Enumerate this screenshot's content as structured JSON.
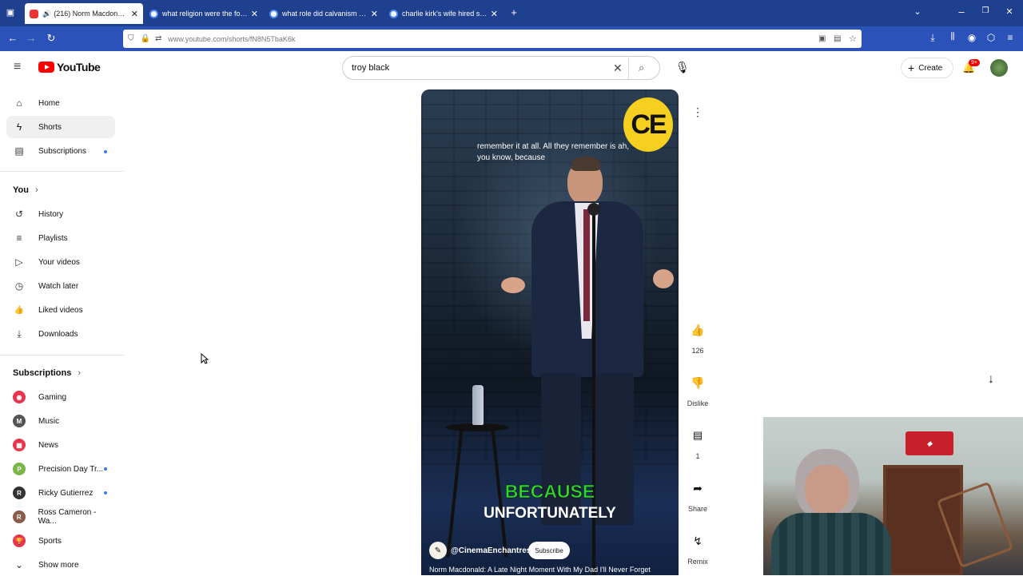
{
  "browser": {
    "tabs": [
      {
        "title": "(216) Norm Macdonald: A L",
        "fav": "#e33",
        "active": true
      },
      {
        "title": "what religion were the founding",
        "fav": "#4a8af4",
        "active": false
      },
      {
        "title": "what role did calvanism play in",
        "fav": "#4a8af4",
        "active": false
      },
      {
        "title": "charlie kirk's wife hired someon",
        "fav": "#4a8af4",
        "active": false
      }
    ],
    "url": "www.youtube.com/shorts/fN8N5TbaK6k"
  },
  "youtube": {
    "logo": "YouTube",
    "search_value": "troy black",
    "create_label": "Create",
    "notif_badge": "9+"
  },
  "sidebar": {
    "main": [
      {
        "label": "Home",
        "icon": "home-icon",
        "glyph": "⌂"
      },
      {
        "label": "Shorts",
        "icon": "shorts-icon",
        "glyph": "ϟ"
      },
      {
        "label": "Subscriptions",
        "icon": "subscriptions-icon",
        "glyph": "▤"
      }
    ],
    "you_title": "You",
    "you": [
      {
        "label": "History",
        "icon": "history-icon",
        "glyph": "↺"
      },
      {
        "label": "Playlists",
        "icon": "playlists-icon",
        "glyph": "≡"
      },
      {
        "label": "Your videos",
        "icon": "your-videos-icon",
        "glyph": "▷"
      },
      {
        "label": "Watch later",
        "icon": "watch-later-icon",
        "glyph": "◷"
      },
      {
        "label": "Liked videos",
        "icon": "liked-videos-icon",
        "glyph": "👍"
      },
      {
        "label": "Downloads",
        "icon": "downloads-icon",
        "glyph": "⤓"
      }
    ],
    "subs_title": "Subscriptions",
    "subs": [
      {
        "label": "Gaming",
        "color": "#e8344c",
        "letter": "◉"
      },
      {
        "label": "Music",
        "color": "#555555",
        "letter": "M"
      },
      {
        "label": "News",
        "color": "#e8344c",
        "letter": "▦"
      },
      {
        "label": "Precision Day Tr...",
        "color": "#7ab648",
        "letter": "P"
      },
      {
        "label": "Ricky Gutierrez",
        "color": "#333333",
        "letter": "R"
      },
      {
        "label": "Ross Cameron - Wa...",
        "color": "#8a5a4a",
        "letter": "R"
      },
      {
        "label": "Sports",
        "color": "#e8344c",
        "letter": "🏆"
      }
    ],
    "show_more": "Show more"
  },
  "short": {
    "caption": "remember it at all. All they remember is ah, you know, because",
    "badge": "CE",
    "big_line1": "BECAUSE",
    "big_line2": "UNFORTUNATELY",
    "channel": "@CinemaEnchantress",
    "subscribe": "Subscribe",
    "title": "Norm Macdonald: A Late Night Moment With My Dad I'll Never Forget",
    "likes": "126",
    "dislike": "Dislike",
    "comments": "1",
    "share": "Share",
    "remix": "Remix"
  }
}
